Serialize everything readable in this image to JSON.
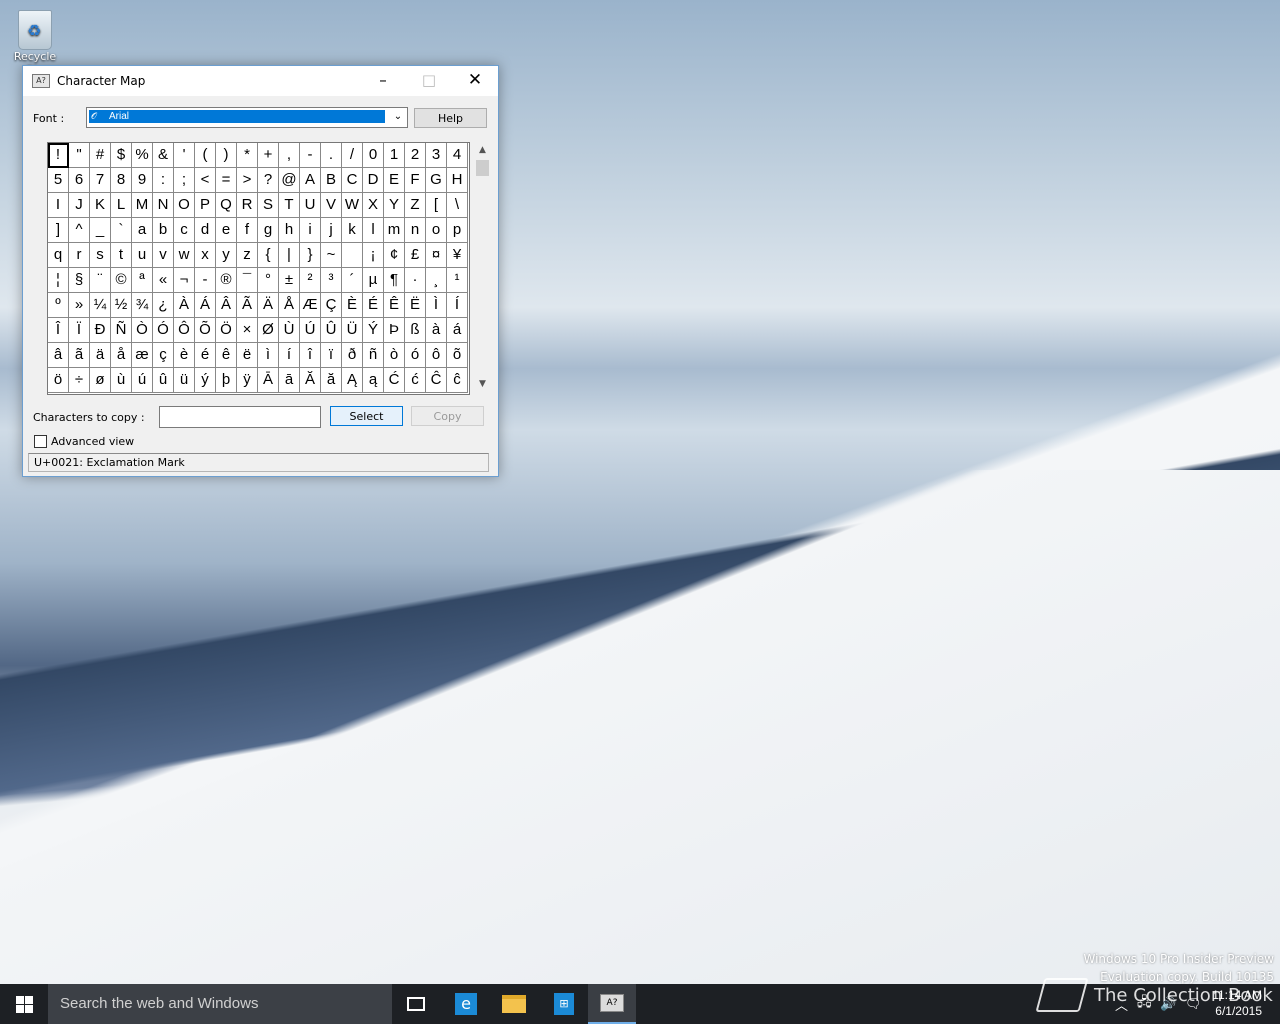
{
  "desktop": {
    "recycle_bin_label": "Recycle Bin",
    "watermark_line1": "Windows 10 Pro Insider Preview",
    "watermark_line2": "Evaluation copy. Build 10135",
    "brand": "The Collection Book"
  },
  "window": {
    "title": "Character Map",
    "icon": "charmap-icon",
    "minimize": "–",
    "maximize": "□",
    "close": "✕"
  },
  "font": {
    "label": "Font :",
    "selected": "Arial",
    "icon": "opentype-font-icon"
  },
  "buttons": {
    "help": "Help",
    "select": "Select",
    "copy": "Copy"
  },
  "characters": [
    "!",
    "\"",
    "#",
    "$",
    "%",
    "&",
    "'",
    "(",
    ")",
    "*",
    "+",
    ",",
    "-",
    ".",
    "/",
    "0",
    "1",
    "2",
    "3",
    "4",
    "5",
    "6",
    "7",
    "8",
    "9",
    ":",
    ";",
    "<",
    "=",
    ">",
    "?",
    "@",
    "A",
    "B",
    "C",
    "D",
    "E",
    "F",
    "G",
    "H",
    "I",
    "J",
    "K",
    "L",
    "M",
    "N",
    "O",
    "P",
    "Q",
    "R",
    "S",
    "T",
    "U",
    "V",
    "W",
    "X",
    "Y",
    "Z",
    "[",
    "\\",
    "]",
    "^",
    "_",
    "`",
    "a",
    "b",
    "c",
    "d",
    "e",
    "f",
    "g",
    "h",
    "i",
    "j",
    "k",
    "l",
    "m",
    "n",
    "o",
    "p",
    "q",
    "r",
    "s",
    "t",
    "u",
    "v",
    "w",
    "x",
    "y",
    "z",
    "{",
    "|",
    "}",
    "~",
    " ",
    "¡",
    "¢",
    "£",
    "¤",
    "¥",
    "¦",
    "§",
    "¨",
    "©",
    "ª",
    "«",
    "¬",
    "-",
    "®",
    "¯",
    "°",
    "±",
    "²",
    "³",
    "´",
    "µ",
    "¶",
    "·",
    "¸",
    "¹",
    "º",
    "»",
    "¼",
    "½",
    "¾",
    "¿",
    "À",
    "Á",
    "Â",
    "Ã",
    "Ä",
    "Å",
    "Æ",
    "Ç",
    "È",
    "É",
    "Ê",
    "Ë",
    "Ì",
    "Í",
    "Î",
    "Ï",
    "Ð",
    "Ñ",
    "Ò",
    "Ó",
    "Ô",
    "Õ",
    "Ö",
    "×",
    "Ø",
    "Ù",
    "Ú",
    "Û",
    "Ü",
    "Ý",
    "Þ",
    "ß",
    "à",
    "á",
    "â",
    "ã",
    "ä",
    "å",
    "æ",
    "ç",
    "è",
    "é",
    "ê",
    "ë",
    "ì",
    "í",
    "î",
    "ï",
    "ð",
    "ñ",
    "ò",
    "ó",
    "ô",
    "õ",
    "ö",
    "÷",
    "ø",
    "ù",
    "ú",
    "û",
    "ü",
    "ý",
    "þ",
    "ÿ",
    "Ā",
    "ā",
    "Ă",
    "ă",
    "Ą",
    "ą",
    "Ć",
    "ć",
    "Ĉ",
    "ĉ"
  ],
  "copy": {
    "label": "Characters to copy :",
    "value": ""
  },
  "advanced_view": {
    "label": "Advanced view",
    "checked": false
  },
  "status": "U+0021: Exclamation Mark",
  "taskbar": {
    "search_placeholder": "Search the web and Windows",
    "time": "11:14 AM",
    "date": "6/1/2015"
  }
}
